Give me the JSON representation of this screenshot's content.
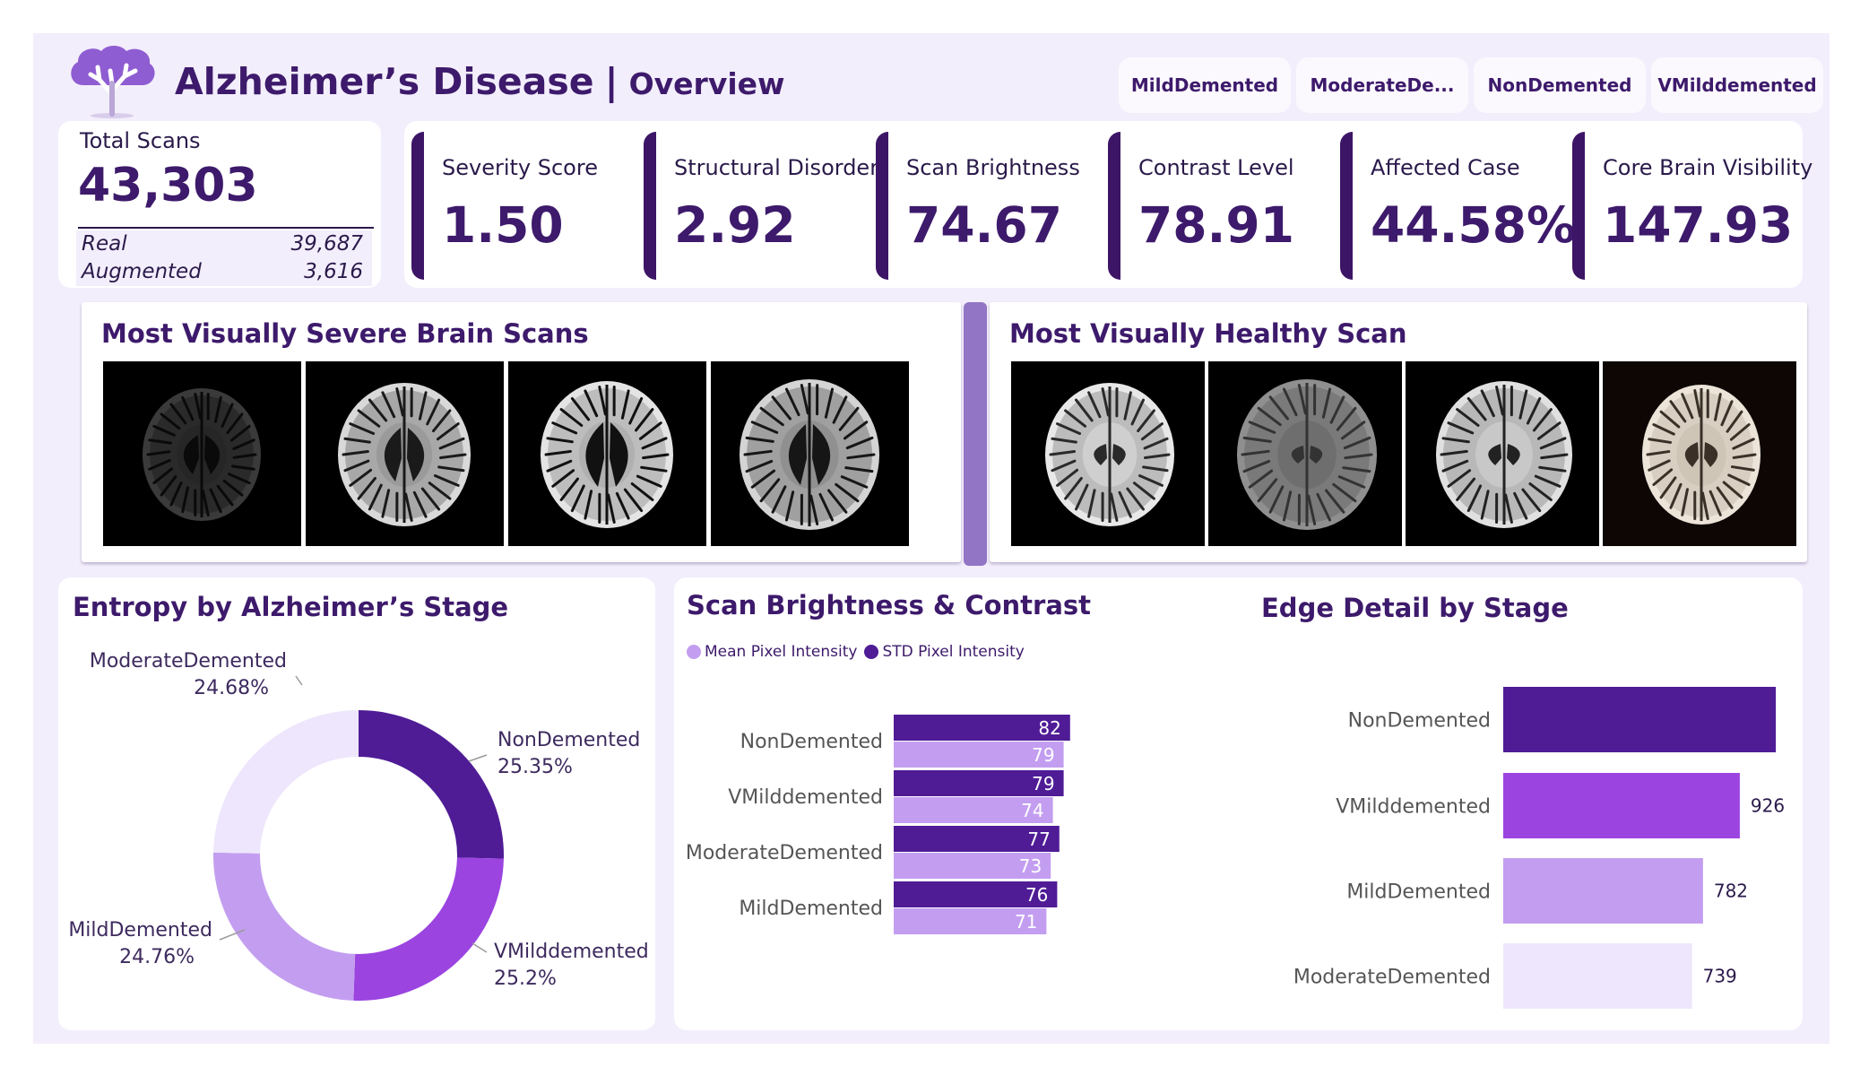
{
  "header": {
    "title": "Alzheimer’s Disease",
    "separator": "|",
    "subtitle": "Overview",
    "logo_icon": "brain-tree-icon"
  },
  "slicers": [
    "MildDemented",
    "ModerateDe...",
    "NonDemented",
    "VMilddemented"
  ],
  "total_scans": {
    "label": "Total Scans",
    "value": "43,303",
    "rows": [
      {
        "label": "Real",
        "value": "39,687"
      },
      {
        "label": "Augmented",
        "value": "3,616"
      }
    ]
  },
  "kpis": [
    {
      "label": "Severity Score",
      "value": "1.50"
    },
    {
      "label": "Structural Disorder",
      "value": "2.92"
    },
    {
      "label": "Scan Brightness",
      "value": "74.67"
    },
    {
      "label": "Contrast Level",
      "value": "78.91"
    },
    {
      "label": "Affected Case",
      "value": "44.58%"
    },
    {
      "label": "Core Brain Visibility",
      "value": "147.93"
    }
  ],
  "severe_panel": {
    "title": "Most Visually Severe Brain Scans"
  },
  "healthy_panel": {
    "title": "Most Visually Healthy Scan"
  },
  "colors": {
    "accent_dark": "#3d1566",
    "nondemented": "#4f1c96",
    "vmild": "#9b44e0",
    "mild": "#c39ef0",
    "moderate": "#eee6fc",
    "std_bar": "#4f1c96",
    "mean_bar": "#c39ef0"
  },
  "chart_data": [
    {
      "type": "pie",
      "title": "Entropy by Alzheimer’s Stage",
      "donut": true,
      "slices": [
        {
          "label": "NonDemented",
          "value": 25.35,
          "display": "25.35%"
        },
        {
          "label": "VMilddemented",
          "value": 25.2,
          "display": "25.2%"
        },
        {
          "label": "MildDemented",
          "value": 24.76,
          "display": "24.76%"
        },
        {
          "label": "ModerateDemented",
          "value": 24.68,
          "display": "24.68%"
        }
      ]
    },
    {
      "type": "bar",
      "orientation": "horizontal",
      "title": "Scan Brightness & Contrast",
      "categories": [
        "NonDemented",
        "VMilddemented",
        "ModerateDemented",
        "MildDemented"
      ],
      "series": [
        {
          "name": "STD Pixel Intensity",
          "values": [
            82,
            79,
            77,
            76
          ]
        },
        {
          "name": "Mean Pixel Intensity",
          "values": [
            79,
            74,
            73,
            71
          ]
        }
      ],
      "legend": [
        "Mean Pixel Intensity",
        "STD Pixel Intensity"
      ],
      "legend_position": "top-left"
    },
    {
      "type": "bar",
      "orientation": "horizontal",
      "title": "Edge Detail by Stage",
      "categories": [
        "NonDemented",
        "VMilddemented",
        "MildDemented",
        "ModerateDemented"
      ],
      "values": [
        1067,
        926,
        782,
        739
      ]
    }
  ]
}
